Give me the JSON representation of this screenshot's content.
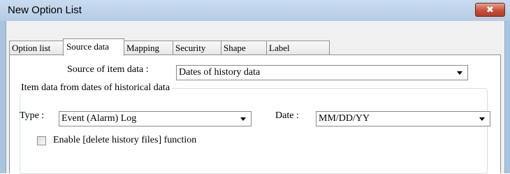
{
  "window": {
    "title": "New Option List",
    "close_label": "✖",
    "colors": {
      "titlebar": "#b4cce4",
      "close": "#c7503a",
      "client": "#f0f0f0"
    }
  },
  "tabs": [
    {
      "label": "Option list",
      "active": false
    },
    {
      "label": "Source data",
      "active": true
    },
    {
      "label": "Mapping",
      "active": false
    },
    {
      "label": "Security",
      "active": false
    },
    {
      "label": "Shape",
      "active": false
    },
    {
      "label": "Label",
      "active": false
    }
  ],
  "source": {
    "label": "Source of item data :",
    "value": "Dates of history data"
  },
  "group": {
    "title": "Item data from dates of historical data",
    "type_label": "Type :",
    "type_value": "Event (Alarm) Log",
    "date_label": "Date :",
    "date_value": "MM/DD/YY",
    "checkbox_label": "Enable [delete history files] function",
    "checkbox_checked": false
  }
}
